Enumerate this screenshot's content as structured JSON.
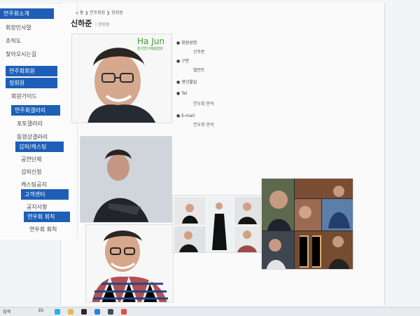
{
  "breadcrumb": {
    "items": [
      "홈",
      "연주회원",
      "정회원"
    ],
    "home_icon": "home-icon"
  },
  "page": {
    "title": "신하준",
    "subtitle": "| 정회원"
  },
  "sidebar": {
    "sections": [
      {
        "header": "연주회소개",
        "items": [
          "회장인사말",
          "조직도",
          "찾아오시는길"
        ]
      },
      {
        "header": "연주회회원",
        "items": []
      },
      {
        "header": "정회원",
        "items": [
          "회원가이드"
        ]
      },
      {
        "header": "연주회갤러리",
        "items": [
          "포토갤러리",
          "동영상갤러리"
        ]
      },
      {
        "header": "섭외/캐스팅",
        "items": [
          "공연단체",
          "섭외신청",
          "캐스팅공지"
        ]
      },
      {
        "header": "고객센터",
        "items": [
          "공지사항"
        ]
      },
      {
        "header": "연우회 회칙",
        "items": [
          "연우회 회칙"
        ]
      }
    ]
  },
  "profile": {
    "logo_text": "Ha Jun",
    "logo_sub": "한국연기예술협회",
    "fields": [
      {
        "label": "회원성명",
        "value": "신하준"
      },
      {
        "label": "구분",
        "value": "탤런트"
      },
      {
        "label": "생년월일",
        "value": ""
      },
      {
        "label": "Tel",
        "value": "연우회 문의"
      },
      {
        "label": "E-mail",
        "value": "연우회 문의"
      }
    ]
  },
  "taskbar": {
    "search_label": "검색",
    "weather_label": "Eh"
  },
  "colors": {
    "accent": "#1d5fb6",
    "logo_green": "#3f9a2f"
  }
}
